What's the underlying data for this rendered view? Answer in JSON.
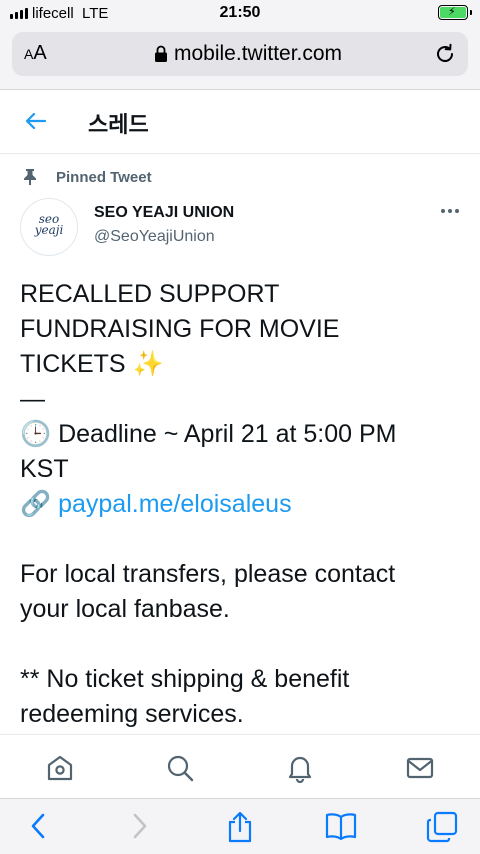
{
  "status_bar": {
    "carrier": "lifecell",
    "network": "LTE",
    "time": "21:50"
  },
  "browser": {
    "text_size_button": "AA",
    "url": "mobile.twitter.com"
  },
  "header": {
    "title": "스레드"
  },
  "tweet": {
    "pinned_label": "Pinned Tweet",
    "author_name": "SEO YEAJI UNION",
    "author_handle": "@SeoYeajiUnion",
    "avatar_logo_line1": "seo",
    "avatar_logo_line2": "yeaji",
    "lines": {
      "l1": "RECALLED SUPPORT",
      "l2": "FUNDRAISING FOR MOVIE",
      "l3": "TICKETS",
      "l3_emoji": "✨",
      "l4": "—",
      "l5_emoji": "🕒",
      "l5": "Deadline ~ April 21 at 5:00 PM",
      "l6": "KST",
      "l7_emoji": "🔗",
      "l7_link": "paypal.me/eloisaleus",
      "l9": "For local transfers, please contact",
      "l10": "your local fanbase.",
      "l12": "** No ticket shipping & benefit",
      "l13": "redeeming services."
    }
  },
  "colors": {
    "accent": "#1d9bf0",
    "secondary_text": "#536471",
    "chrome": "#f4f4f6",
    "safari_blue": "#0a7aff",
    "battery": "#4cd964"
  },
  "icons": {
    "status": [
      "signal-icon",
      "battery-charging-icon"
    ],
    "browser_top": [
      "lock-icon",
      "reload-icon"
    ],
    "header": [
      "back-arrow-icon"
    ],
    "tweet": [
      "pin-icon",
      "more-options-icon"
    ],
    "twitter_nav": [
      "home-icon",
      "search-icon",
      "notifications-icon",
      "messages-icon"
    ],
    "safari_toolbar": [
      "back-icon",
      "forward-icon",
      "share-icon",
      "bookmarks-icon",
      "tabs-icon"
    ]
  }
}
